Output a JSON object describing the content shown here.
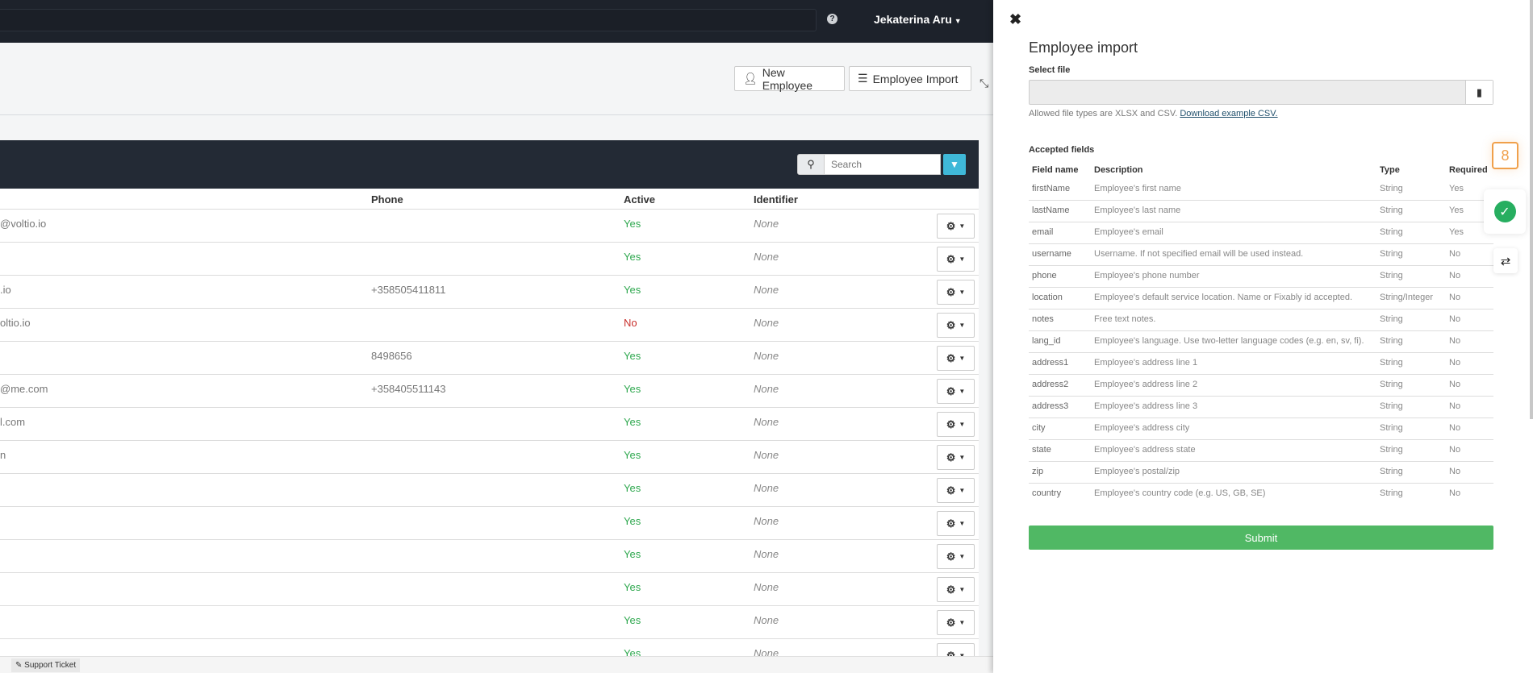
{
  "topbar": {
    "help_icon": "question-circle-icon",
    "user_name": "Jekaterina Aru"
  },
  "header": {
    "new_employee": "New Employee",
    "employee_import": "Employee Import"
  },
  "table": {
    "search_placeholder": "Search",
    "columns": {
      "phone": "Phone",
      "active": "Active",
      "identifier": "Identifier"
    },
    "rows": [
      {
        "email": "@voltio.io",
        "phone": "",
        "active": "Yes",
        "identifier": "None"
      },
      {
        "email": "",
        "phone": "",
        "active": "Yes",
        "identifier": "None"
      },
      {
        "email": ".io",
        "phone": "+358505411811",
        "active": "Yes",
        "identifier": "None"
      },
      {
        "email": "oltio.io",
        "phone": "",
        "active": "No",
        "identifier": "None"
      },
      {
        "email": "",
        "phone": "8498656",
        "active": "Yes",
        "identifier": "None"
      },
      {
        "email": "@me.com",
        "phone": "+358405511143",
        "active": "Yes",
        "identifier": "None"
      },
      {
        "email": "l.com",
        "phone": "",
        "active": "Yes",
        "identifier": "None"
      },
      {
        "email": "n",
        "phone": "",
        "active": "Yes",
        "identifier": "None"
      },
      {
        "email": "",
        "phone": "",
        "active": "Yes",
        "identifier": "None"
      },
      {
        "email": "",
        "phone": "",
        "active": "Yes",
        "identifier": "None"
      },
      {
        "email": "",
        "phone": "",
        "active": "Yes",
        "identifier": "None"
      },
      {
        "email": "",
        "phone": "",
        "active": "Yes",
        "identifier": "None"
      },
      {
        "email": "",
        "phone": "",
        "active": "Yes",
        "identifier": "None"
      },
      {
        "email": "",
        "phone": "",
        "active": "Yes",
        "identifier": "None"
      }
    ]
  },
  "footer": {
    "support_ticket": "Support Ticket"
  },
  "panel": {
    "title": "Employee import",
    "select_file": "Select file",
    "hint": "Allowed file types are XLSX and CSV.",
    "download_link": "Download example CSV.",
    "accepted_fields": "Accepted fields",
    "columns": {
      "field": "Field name",
      "description": "Description",
      "type": "Type",
      "required": "Required"
    },
    "fields": [
      {
        "field": "firstName",
        "description": "Employee's first name",
        "type": "String",
        "required": "Yes"
      },
      {
        "field": "lastName",
        "description": "Employee's last name",
        "type": "String",
        "required": "Yes"
      },
      {
        "field": "email",
        "description": "Employee's email",
        "type": "String",
        "required": "Yes"
      },
      {
        "field": "username",
        "description": "Username. If not specified email will be used instead.",
        "type": "String",
        "required": "No"
      },
      {
        "field": "phone",
        "description": "Employee's phone number",
        "type": "String",
        "required": "No"
      },
      {
        "field": "location",
        "description": "Employee's default service location. Name or Fixably id accepted.",
        "type": "String/Integer",
        "required": "No"
      },
      {
        "field": "notes",
        "description": "Free text notes.",
        "type": "String",
        "required": "No"
      },
      {
        "field": "lang_id",
        "description": "Employee's language. Use two-letter language codes (e.g. en, sv, fi).",
        "type": "String",
        "required": "No"
      },
      {
        "field": "address1",
        "description": "Employee's address line 1",
        "type": "String",
        "required": "No"
      },
      {
        "field": "address2",
        "description": "Employee's address line 2",
        "type": "String",
        "required": "No"
      },
      {
        "field": "address3",
        "description": "Employee's address line 3",
        "type": "String",
        "required": "No"
      },
      {
        "field": "city",
        "description": "Employee's address city",
        "type": "String",
        "required": "No"
      },
      {
        "field": "state",
        "description": "Employee's address state",
        "type": "String",
        "required": "No"
      },
      {
        "field": "zip",
        "description": "Employee's postal/zip",
        "type": "String",
        "required": "No"
      },
      {
        "field": "country",
        "description": "Employee's country code (e.g. US, GB, SE)",
        "type": "String",
        "required": "No"
      }
    ],
    "submit": "Submit"
  },
  "widgets": {
    "badge_count": "8",
    "accent": "#f0a04b",
    "success": "#27ae60"
  }
}
